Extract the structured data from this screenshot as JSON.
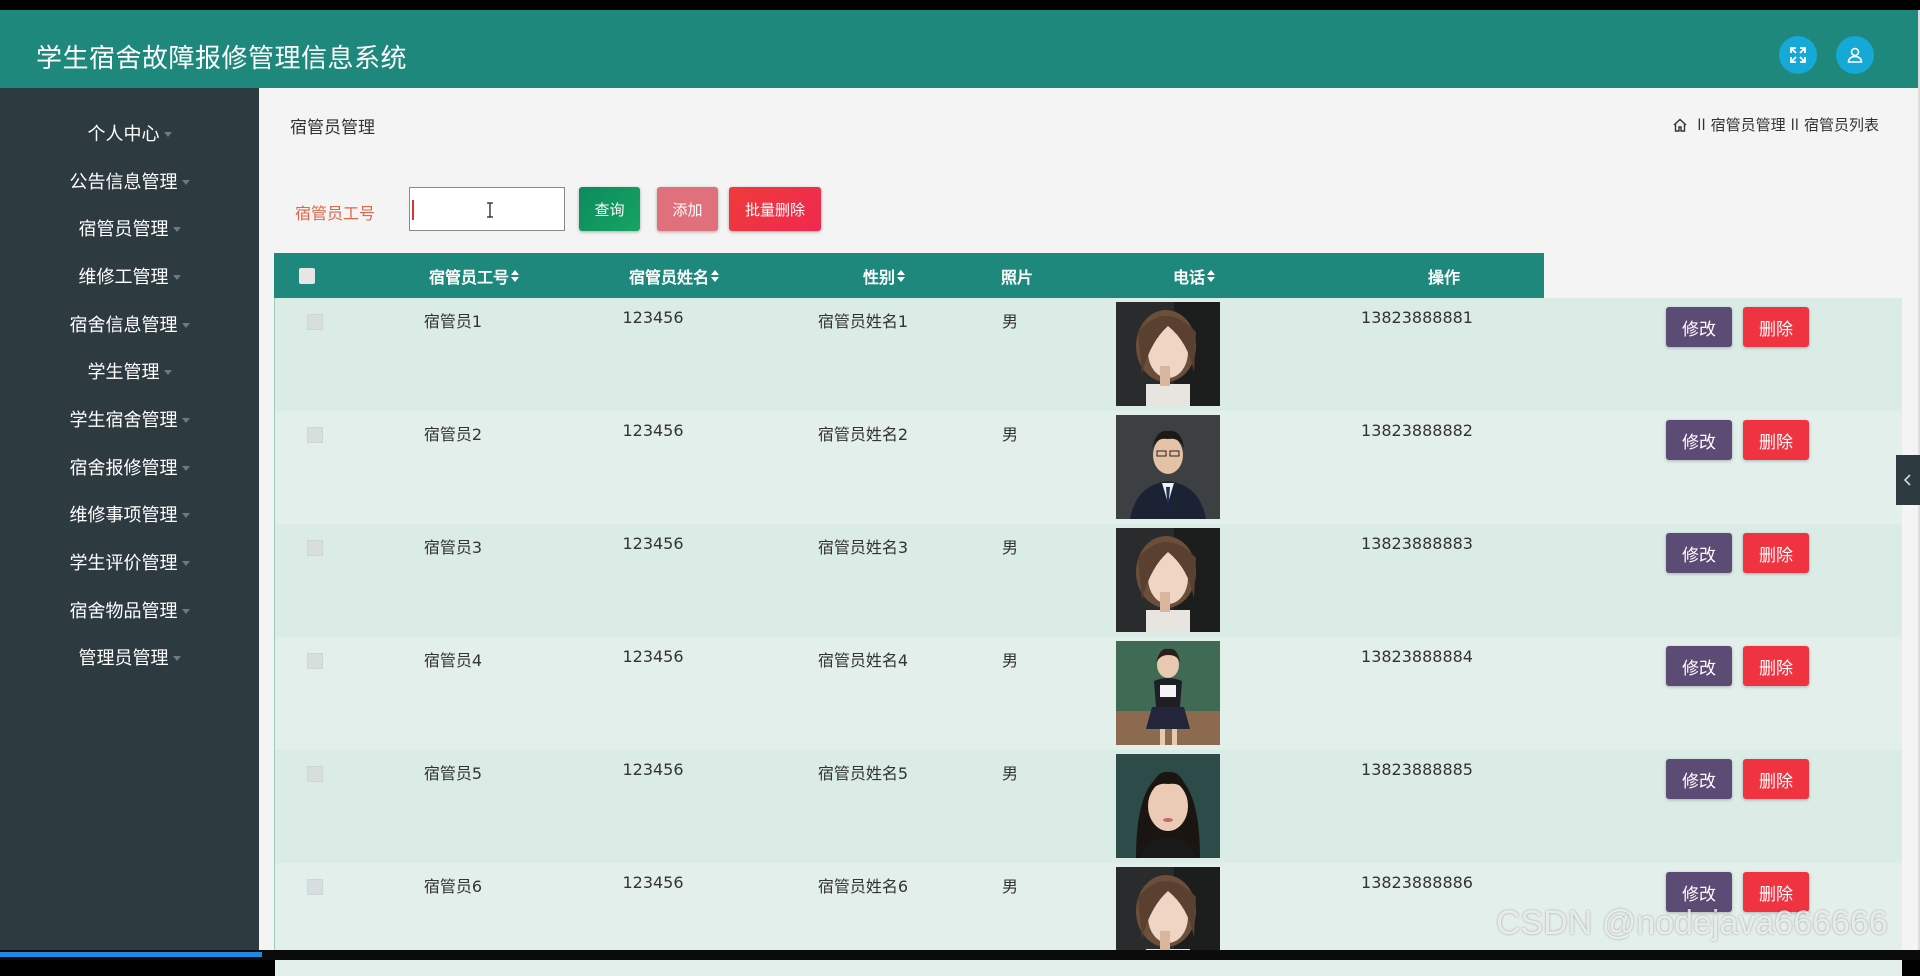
{
  "app": {
    "title": "学生宿舍故障报修管理信息系统"
  },
  "sidebar": {
    "items": [
      {
        "label": "个人中心"
      },
      {
        "label": "公告信息管理"
      },
      {
        "label": "宿管员管理"
      },
      {
        "label": "维修工管理"
      },
      {
        "label": "宿舍信息管理"
      },
      {
        "label": "学生管理"
      },
      {
        "label": "学生宿舍管理"
      },
      {
        "label": "宿舍报修管理"
      },
      {
        "label": "维修事项管理"
      },
      {
        "label": "学生评价管理"
      },
      {
        "label": "宿舍物品管理"
      },
      {
        "label": "管理员管理"
      }
    ]
  },
  "page": {
    "title": "宿管员管理",
    "breadcrumb": {
      "sep": "ll",
      "section": "宿管员管理",
      "page": "宿管员列表"
    }
  },
  "search": {
    "label": "宿管员工号",
    "value": "",
    "query_label": "查询",
    "add_label": "添加",
    "batch_delete_label": "批量删除"
  },
  "table": {
    "headers": {
      "id": "宿管员工号",
      "name": "宿管员姓名",
      "gender": "性别",
      "photo": "照片",
      "phone": "电话",
      "ops": "操作"
    },
    "edit_label": "修改",
    "delete_label": "删除",
    "rows": [
      {
        "id": "宿管员1",
        "pwd": "123456",
        "name": "宿管员姓名1",
        "gender": "男",
        "phone": "13823888881",
        "photo": "woman-portrait"
      },
      {
        "id": "宿管员2",
        "pwd": "123456",
        "name": "宿管员姓名2",
        "gender": "男",
        "phone": "13823888882",
        "photo": "man-suit"
      },
      {
        "id": "宿管员3",
        "pwd": "123456",
        "name": "宿管员姓名3",
        "gender": "男",
        "phone": "13823888883",
        "photo": "woman-portrait"
      },
      {
        "id": "宿管员4",
        "pwd": "123456",
        "name": "宿管员姓名4",
        "gender": "男",
        "phone": "13823888884",
        "photo": "woman-uniform"
      },
      {
        "id": "宿管员5",
        "pwd": "123456",
        "name": "宿管员姓名5",
        "gender": "男",
        "phone": "13823888885",
        "photo": "woman-dark"
      },
      {
        "id": "宿管员6",
        "pwd": "123456",
        "name": "宿管员姓名6",
        "gender": "男",
        "phone": "13823888886",
        "photo": "woman-portrait"
      }
    ]
  },
  "watermark": "CSDN @nodejava666666",
  "colors": {
    "header": "#1e887d",
    "sidebar": "#2d3a40",
    "query": "#0d8a5e",
    "add": "#e0707c",
    "batch": "#f0284f",
    "edit": "#5c4b75",
    "delete": "#ef3340"
  }
}
